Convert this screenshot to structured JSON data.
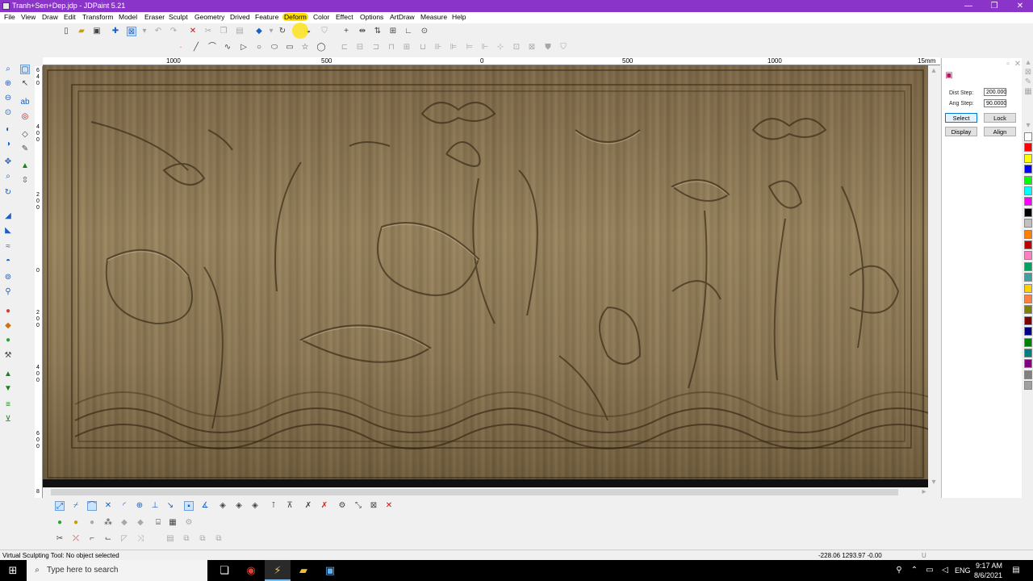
{
  "window": {
    "title": "Tranh+Sen+Dep.jdp - JDPaint 5.21",
    "minimize": "—",
    "maximize": "❐",
    "close": "✕"
  },
  "menu": [
    "File",
    "View",
    "Draw",
    "Edit",
    "Transform",
    "Model",
    "Eraser",
    "Sculpt",
    "Geometry",
    "Drived",
    "Feature",
    "Deform",
    "Color",
    "Effect",
    "Options",
    "ArtDraw",
    "Measure",
    "Help"
  ],
  "menu_highlight": "Deform",
  "ruler": {
    "h_labels": [
      "1000",
      "500",
      "0",
      "500",
      "1000",
      "15mm"
    ],
    "v_labels": [
      "6\n4\n0",
      "4\n0\n0",
      "2\n0\n0",
      "0",
      "2\n0\n0",
      "4\n0\n0",
      "6\n0\n0",
      "8"
    ]
  },
  "panel": {
    "dist_step_label": "Dist Step:",
    "dist_step_value": "200.000",
    "ang_step_label": "Ang Step:",
    "ang_step_value": "90.0000",
    "select_label": "Select",
    "lock_label": "Lock",
    "display_label": "Display",
    "align_label": "Align"
  },
  "palette": [
    "#ffffff",
    "#ff0000",
    "#ffff00",
    "#0000ff",
    "#00ff00",
    "#00ffff",
    "#ff00ff",
    "#000000",
    "#c0c0c0",
    "#ff8000",
    "#c00000",
    "#ff80c0",
    "#00a060",
    "#40a0a0",
    "#ffd000",
    "#ff8040",
    "#808000",
    "#800000",
    "#000080",
    "#008000",
    "#008080",
    "#800080",
    "#808080",
    "#a0a0a0"
  ],
  "status": {
    "message": "Virtual Sculpting Tool: No object selected",
    "coords": "-228.06 1293.97 -0.00",
    "mode": "U"
  },
  "taskbar": {
    "search_placeholder": "Type here to search",
    "lang": "ENG",
    "time": "9:17 AM",
    "date": "8/6/2021"
  }
}
